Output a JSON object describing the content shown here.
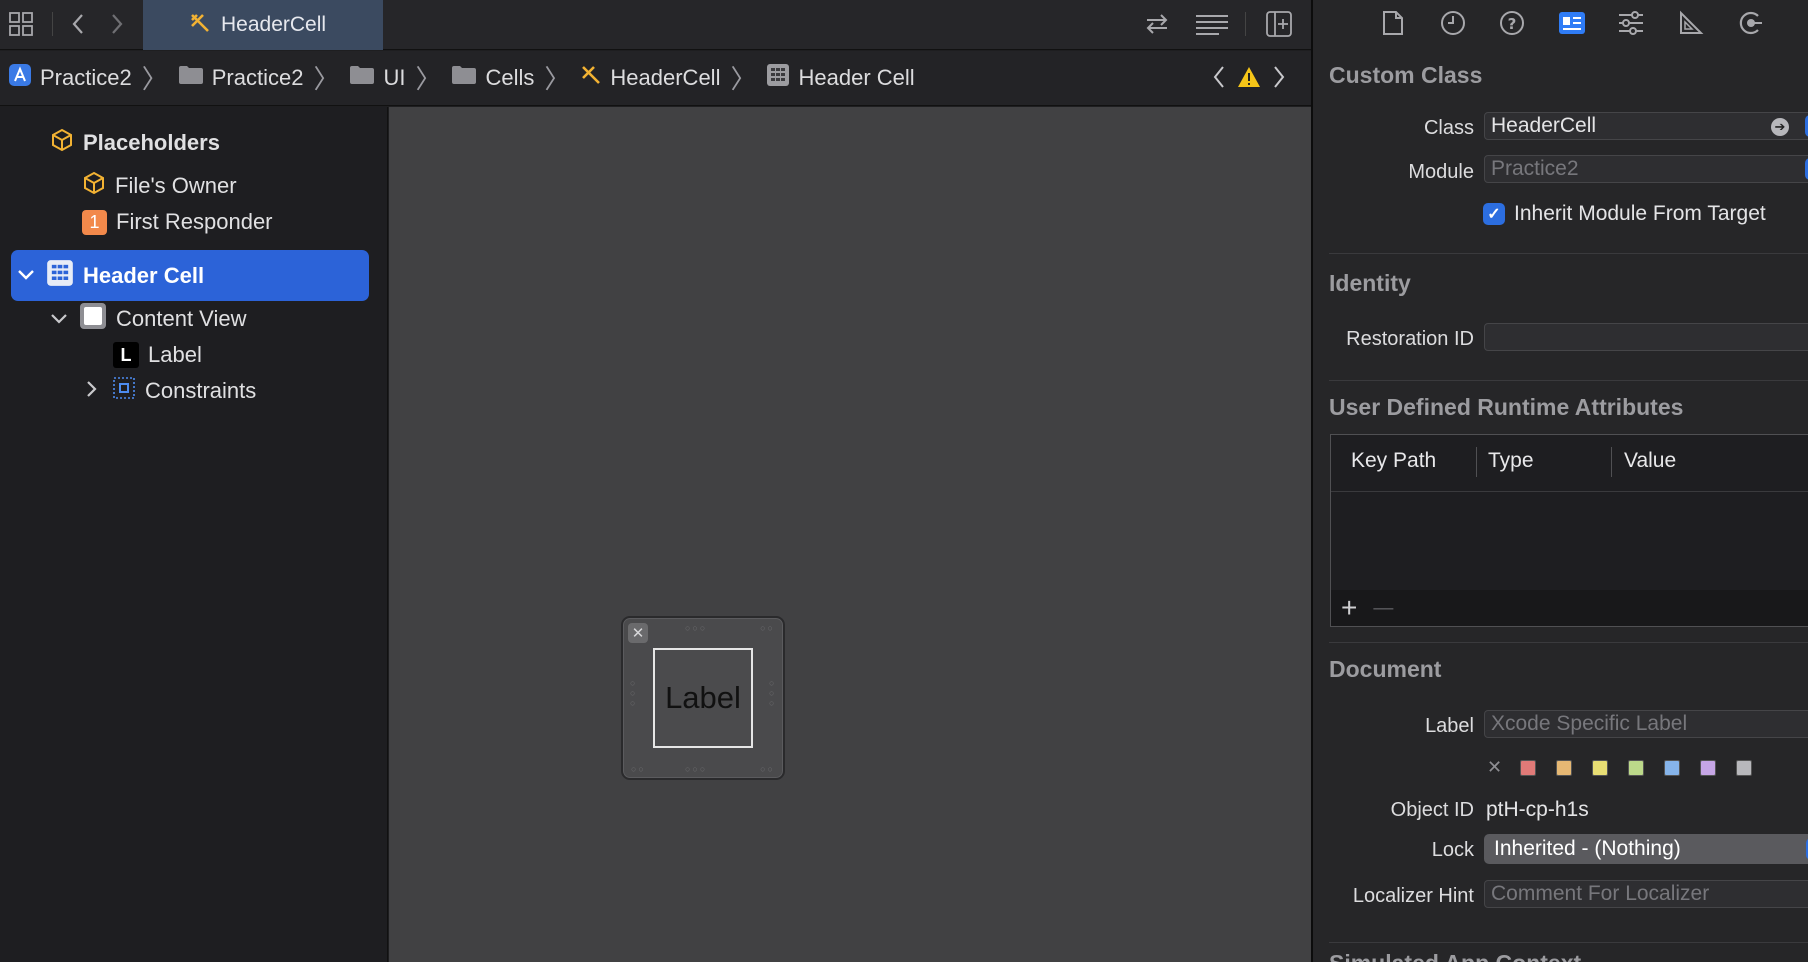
{
  "tab": {
    "active_label": "HeaderCell"
  },
  "breadcrumb": [
    {
      "label": "Practice2",
      "icon": "app-icon"
    },
    {
      "label": "Practice2",
      "icon": "folder-icon"
    },
    {
      "label": "UI",
      "icon": "folder-icon"
    },
    {
      "label": "Cells",
      "icon": "folder-icon"
    },
    {
      "label": "HeaderCell",
      "icon": "xib-icon"
    },
    {
      "label": "Header Cell",
      "icon": "cell-icon"
    }
  ],
  "outline": {
    "placeholders_label": "Placeholders",
    "files_owner_label": "File's Owner",
    "first_responder_label": "First Responder",
    "first_responder_badge": "1",
    "header_cell_label": "Header Cell",
    "content_view_label": "Content View",
    "label_item_label": "Label",
    "label_item_glyph": "L",
    "constraints_label": "Constraints"
  },
  "canvas": {
    "cell_label_text": "Label"
  },
  "inspector": {
    "custom_class": {
      "title": "Custom Class",
      "class_label": "Class",
      "class_value": "HeaderCell",
      "module_label": "Module",
      "module_placeholder": "Practice2",
      "inherit_label": "Inherit Module From Target",
      "inherit_checked": true
    },
    "identity": {
      "title": "Identity",
      "restoration_label": "Restoration ID",
      "restoration_value": ""
    },
    "runtime_attributes": {
      "title": "User Defined Runtime Attributes",
      "columns": [
        "Key Path",
        "Type",
        "Value"
      ],
      "add_label": "+",
      "remove_label": "—"
    },
    "document": {
      "title": "Document",
      "label_label": "Label",
      "label_placeholder": "Xcode Specific Label",
      "swatches": [
        "#e07a78",
        "#e6b874",
        "#e8de74",
        "#bcd98a",
        "#86b4ea",
        "#c6a6e6",
        "#b8b8bc"
      ],
      "object_id_label": "Object ID",
      "object_id_value": "ptH-cp-h1s",
      "lock_label": "Lock",
      "lock_value": "Inherited - (Nothing)",
      "localizer_label": "Localizer Hint",
      "localizer_placeholder": "Comment For Localizer"
    },
    "next_section_title": "Simulated App Context"
  },
  "colors": {
    "accent": "#2c63d8",
    "warning": "#f5c518",
    "xib": "#f2b233"
  }
}
